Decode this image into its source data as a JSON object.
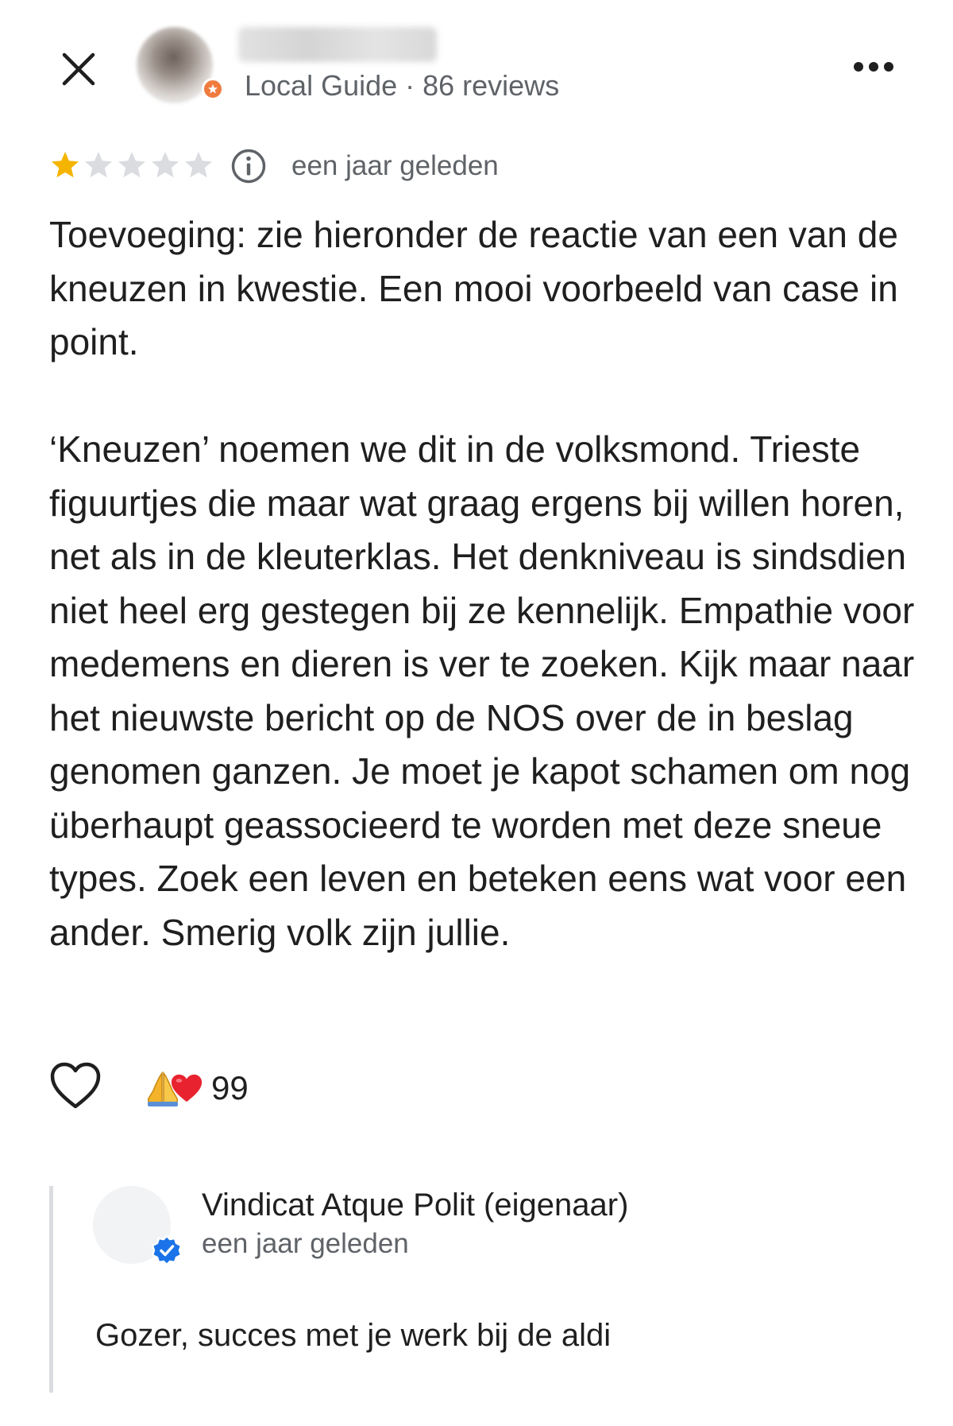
{
  "header": {
    "reviewer_meta": "Local Guide · 86 reviews"
  },
  "review": {
    "rating": 1,
    "rating_max": 5,
    "date": "een jaar geleden",
    "paragraphs": [
      "Toevoeging: zie hieronder de reactie van een van de kneuzen in kwestie. Een mooi voorbeeld van case in point.",
      "‘Kneuzen’ noemen we dit in de volksmond. Trieste figuurtjes die maar wat graag ergens bij willen horen, net als in de kleuterklas. Het denkniveau is sindsdien niet heel erg gestegen bij ze kennelijk. Empathie voor medemens en dieren is ver te zoeken. Kijk maar naar het nieuwste bericht op de NOS over de in beslag genomen ganzen. Je moet je kapot schamen om nog überhaupt geassocieerd te worden met deze sneue types. Zoek een leven en beteken eens wat voor een ander. Smerig volk zijn jullie."
    ]
  },
  "reactions": {
    "emojis": [
      "folded-hands",
      "red-heart"
    ],
    "count": "99"
  },
  "owner_reply": {
    "name": "Vindicat Atque Polit (eigenaar)",
    "date": "een jaar geleden",
    "text": "Gozer, succes met je werk bij de aldi"
  },
  "colors": {
    "star_filled": "#f5b400",
    "star_empty": "#dadce0",
    "secondary_text": "#5f6368",
    "guide_badge": "#f07b3f",
    "verified_badge": "#1a73e8"
  }
}
